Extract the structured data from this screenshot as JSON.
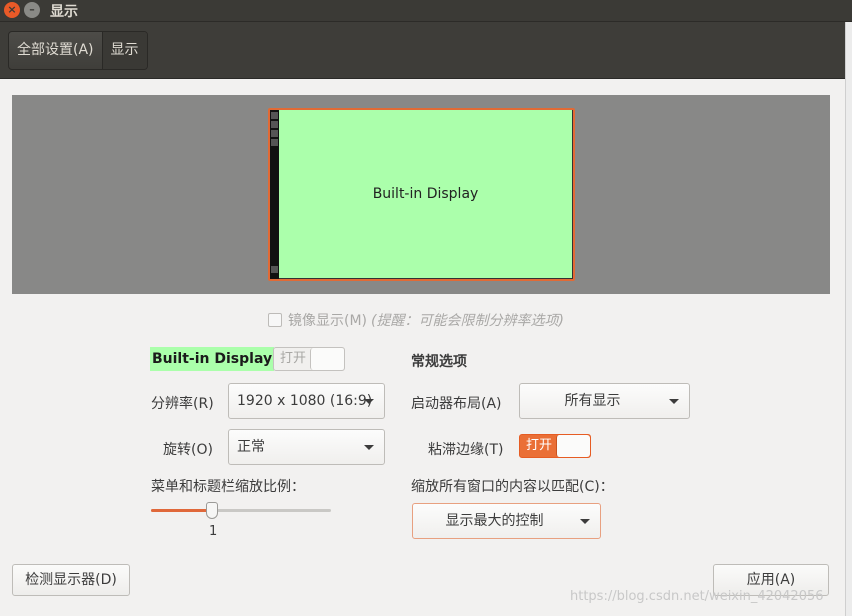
{
  "window": {
    "title": "显示"
  },
  "toolbar": {
    "all_settings": "全部设置(A)",
    "current": "显示"
  },
  "preview": {
    "monitor_label": "Built-in Display"
  },
  "mirror": {
    "label": "镜像显示(M)",
    "hint": "(提醒：可能会限制分辨率选项)",
    "checked": false
  },
  "display": {
    "name": "Built-in Display",
    "power_switch": {
      "text": "打开",
      "on": false
    },
    "resolution": {
      "label": "分辨率(R)",
      "value": "1920 x 1080 (16:9)"
    },
    "rotation": {
      "label": "旋转(O)",
      "value": "正常"
    },
    "scale": {
      "label": "菜单和标题栏缩放比例：",
      "value": "1",
      "fraction": 0.34
    }
  },
  "general": {
    "heading": "常规选项",
    "launcher": {
      "label": "启动器布局(A)",
      "value": "所有显示"
    },
    "sticky": {
      "label": "粘滞边缘(T)",
      "text": "打开",
      "on": true
    },
    "scale_all": {
      "label": "缩放所有窗口的内容以匹配(C)：",
      "value": "显示最大的控制"
    }
  },
  "buttons": {
    "detect": "检测显示器(D)",
    "apply": "应用(A)"
  },
  "watermark": "https://blog.csdn.net/weixin_42042056",
  "colors": {
    "accent": "#e95420",
    "monitor_fill": "#abffab",
    "titlebar": "#3b3a36"
  }
}
